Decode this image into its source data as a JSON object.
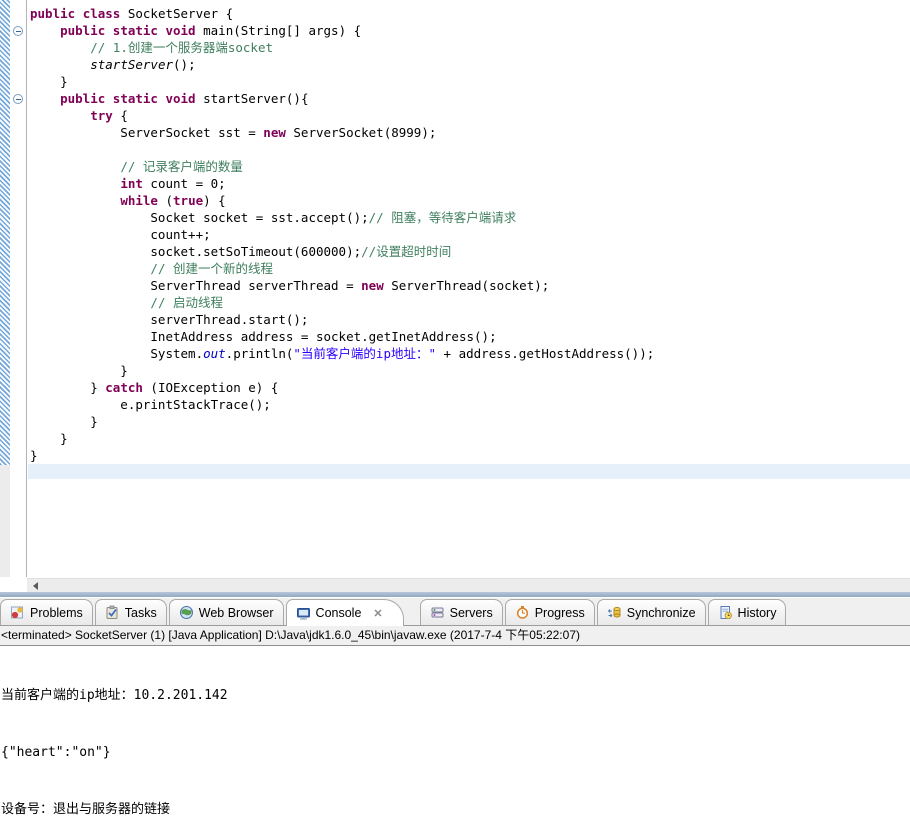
{
  "editor": {
    "lines": [
      [
        [
          "k",
          "public"
        ],
        [
          "d",
          " "
        ],
        [
          "k",
          "class"
        ],
        [
          "d",
          " SocketServer {"
        ]
      ],
      [
        [
          "d",
          "    "
        ],
        [
          "k",
          "public"
        ],
        [
          "d",
          " "
        ],
        [
          "k",
          "static"
        ],
        [
          "d",
          " "
        ],
        [
          "k",
          "void"
        ],
        [
          "d",
          " main(String[] args) {"
        ]
      ],
      [
        [
          "d",
          "        "
        ],
        [
          "c",
          "// 1.创建一个服务器端socket"
        ]
      ],
      [
        [
          "d",
          "        "
        ],
        [
          "i",
          "startServer"
        ],
        [
          "d",
          "();"
        ]
      ],
      [
        [
          "d",
          "    }"
        ]
      ],
      [
        [
          "d",
          "    "
        ],
        [
          "k",
          "public"
        ],
        [
          "d",
          " "
        ],
        [
          "k",
          "static"
        ],
        [
          "d",
          " "
        ],
        [
          "k",
          "void"
        ],
        [
          "d",
          " startServer(){"
        ]
      ],
      [
        [
          "d",
          "        "
        ],
        [
          "k",
          "try"
        ],
        [
          "d",
          " {"
        ]
      ],
      [
        [
          "d",
          "            ServerSocket sst = "
        ],
        [
          "k",
          "new"
        ],
        [
          "d",
          " ServerSocket(8999);"
        ]
      ],
      [],
      [
        [
          "d",
          "            "
        ],
        [
          "c",
          "// 记录客户端的数量"
        ]
      ],
      [
        [
          "d",
          "            "
        ],
        [
          "k",
          "int"
        ],
        [
          "d",
          " count = 0;"
        ]
      ],
      [
        [
          "d",
          "            "
        ],
        [
          "k",
          "while"
        ],
        [
          "d",
          " ("
        ],
        [
          "k",
          "true"
        ],
        [
          "d",
          ") {"
        ]
      ],
      [
        [
          "d",
          "                Socket socket = sst.accept();"
        ],
        [
          "c",
          "// 阻塞，等待客户端请求"
        ]
      ],
      [
        [
          "d",
          "                count++;"
        ]
      ],
      [
        [
          "d",
          "                socket.setSoTimeout(600000);"
        ],
        [
          "c",
          "//设置超时时间"
        ]
      ],
      [
        [
          "d",
          "                "
        ],
        [
          "c",
          "// 创建一个新的线程"
        ]
      ],
      [
        [
          "d",
          "                ServerThread serverThread = "
        ],
        [
          "k",
          "new"
        ],
        [
          "d",
          " ServerThread(socket);"
        ]
      ],
      [
        [
          "d",
          "                "
        ],
        [
          "c",
          "// 启动线程"
        ]
      ],
      [
        [
          "d",
          "                serverThread.start();"
        ]
      ],
      [
        [
          "d",
          "                InetAddress address = socket.getInetAddress();"
        ]
      ],
      [
        [
          "d",
          "                System."
        ],
        [
          "f",
          "out"
        ],
        [
          "d",
          ".println("
        ],
        [
          "s",
          "\"当前客户端的ip地址：\""
        ],
        [
          "d",
          " + address.getHostAddress());"
        ]
      ],
      [
        [
          "d",
          "            }"
        ]
      ],
      [
        [
          "d",
          "        } "
        ],
        [
          "k",
          "catch"
        ],
        [
          "d",
          " (IOException e) {"
        ]
      ],
      [
        [
          "d",
          "            e.printStackTrace();"
        ]
      ],
      [
        [
          "d",
          "        }"
        ]
      ],
      [
        [
          "d",
          "    }"
        ]
      ],
      [
        [
          "d",
          "}"
        ]
      ]
    ]
  },
  "tabs": [
    {
      "label": "Problems",
      "icon": "problems-icon"
    },
    {
      "label": "Tasks",
      "icon": "tasks-icon"
    },
    {
      "label": "Web Browser",
      "icon": "web-browser-icon"
    },
    {
      "label": "Console",
      "icon": "console-icon",
      "active": true,
      "close_glyph": "✕"
    },
    {
      "label": "Servers",
      "icon": "servers-icon"
    },
    {
      "label": "Progress",
      "icon": "progress-icon"
    },
    {
      "label": "Synchronize",
      "icon": "synchronize-icon"
    },
    {
      "label": "History",
      "icon": "history-icon"
    }
  ],
  "console": {
    "header": "<terminated> SocketServer (1) [Java Application] D:\\Java\\jdk1.6.0_45\\bin\\javaw.exe (2017-7-4 下午05:22:07)",
    "lines": [
      "当前客户端的ip地址：10.2.201.142",
      "{\"heart\":\"on\"}",
      "设备号：退出与服务器的链接"
    ]
  },
  "colors": {
    "keyword": "#7f0055",
    "comment": "#3f7f5f",
    "string": "#2a00ff",
    "static_field": "#0000c0",
    "current_line": "#e6f0fb",
    "diff_ruler_blue": "#74a7da",
    "sash": "#92a9c3"
  }
}
